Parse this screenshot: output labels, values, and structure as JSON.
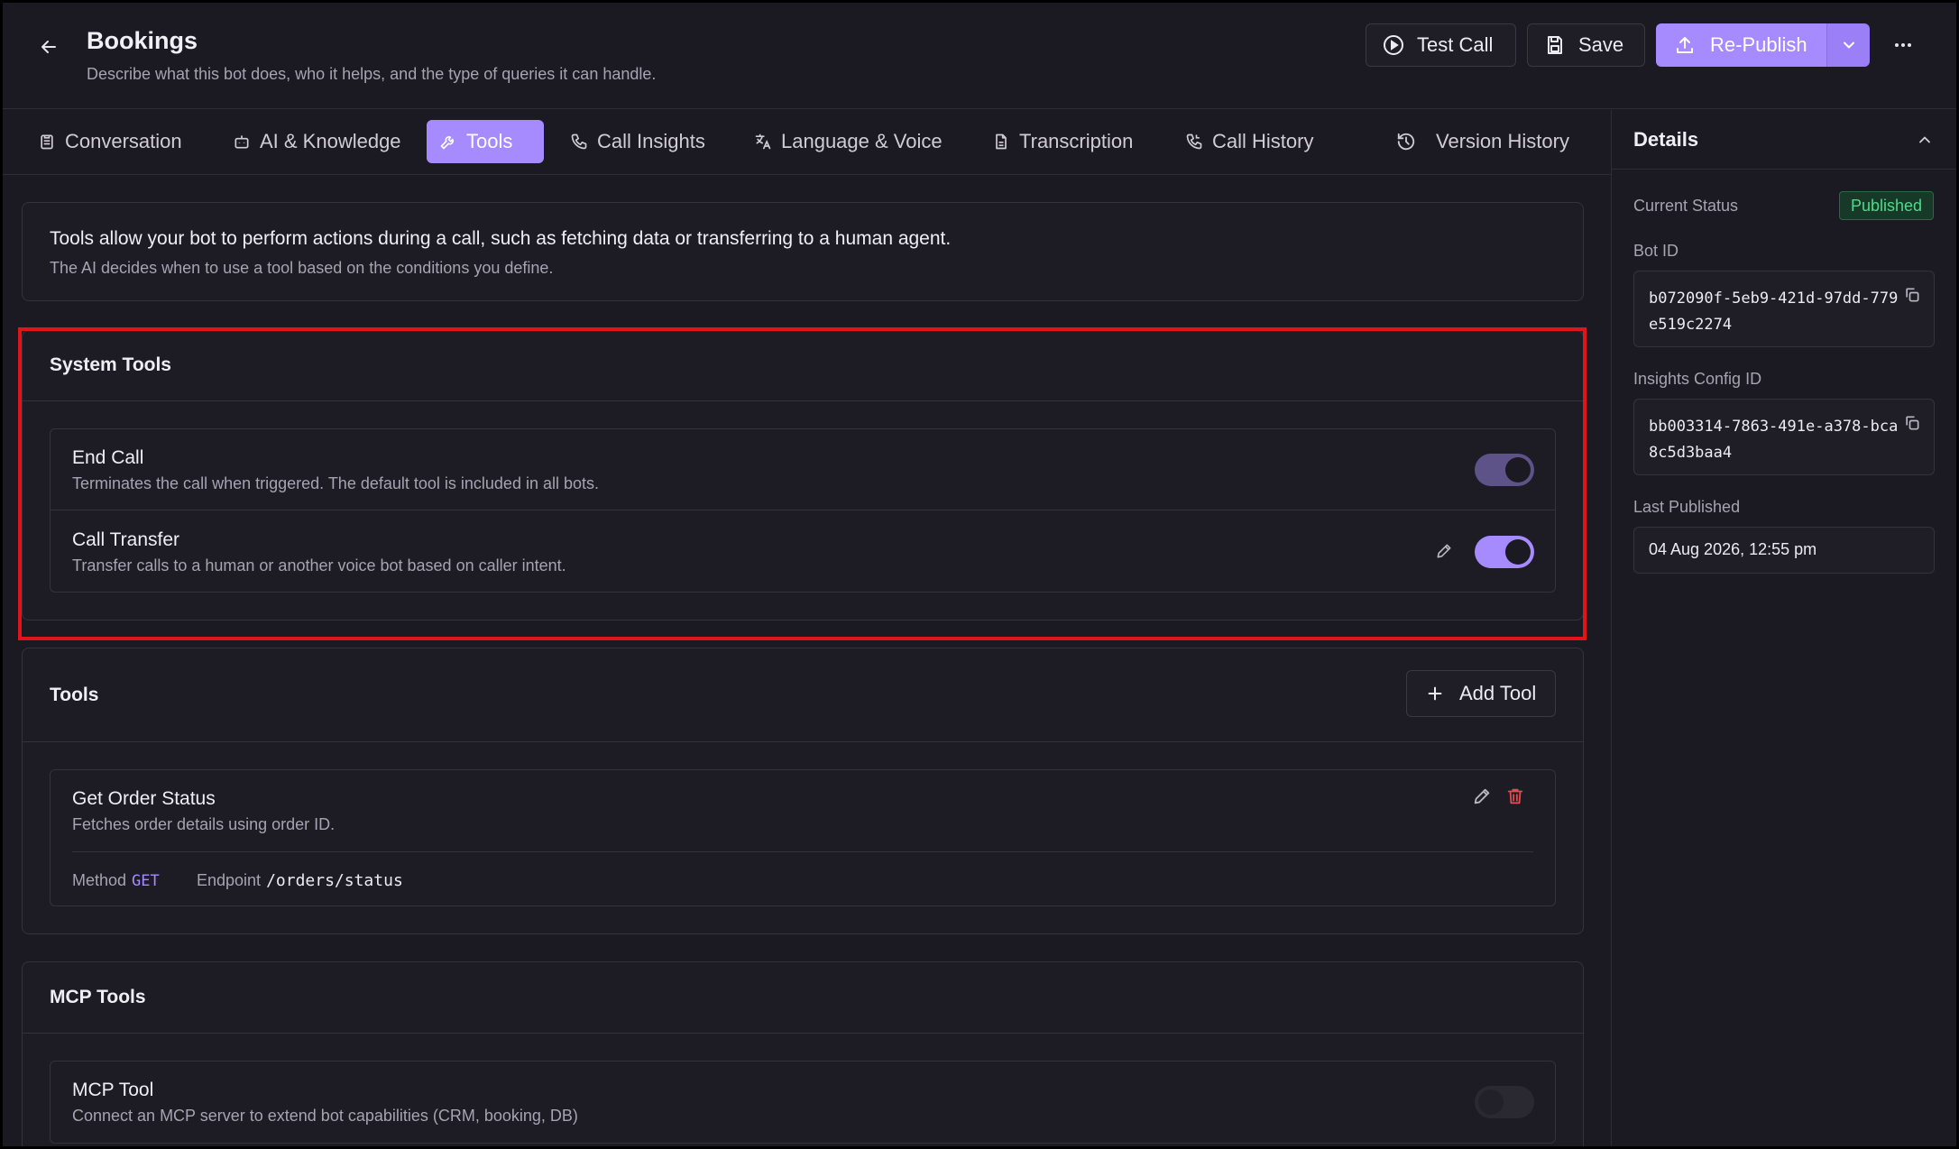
{
  "header": {
    "title": "Bookings",
    "subtitle": "Describe what this bot does, who it helps, and the type of queries it can handle.",
    "test_call_label": "Test Call",
    "save_label": "Save",
    "republish_label": "Re-Publish"
  },
  "tabs": [
    {
      "label": "Conversation",
      "icon": "clipboard-icon"
    },
    {
      "label": "AI & Knowledge",
      "icon": "robot-icon"
    },
    {
      "label": "Tools",
      "icon": "wrench-icon",
      "active": true
    },
    {
      "label": "Call Insights",
      "icon": "phone-icon"
    },
    {
      "label": "Language & Voice",
      "icon": "translate-icon"
    },
    {
      "label": "Transcription",
      "icon": "document-icon"
    },
    {
      "label": "Call History",
      "icon": "phone-history-icon"
    },
    {
      "label": "Version History",
      "icon": "history-icon"
    }
  ],
  "info": {
    "title": "Tools allow your bot to perform actions during a call, such as fetching data or transferring to a human agent.",
    "subtitle": "The AI decides when to use a tool based on the conditions you define."
  },
  "system_tools": {
    "title": "System Tools",
    "items": [
      {
        "name": "End Call",
        "description": "Terminates the call when triggered. The default tool is included in all bots.",
        "enabled": true
      },
      {
        "name": "Call Transfer",
        "description": "Transfer calls to a human or another voice bot based on caller intent.",
        "enabled": true
      }
    ]
  },
  "tools": {
    "title": "Tools",
    "add_label": "Add Tool",
    "items": [
      {
        "name": "Get Order Status",
        "description": "Fetches order details using order ID.",
        "method_label": "Method",
        "method": "GET",
        "endpoint_label": "Endpoint",
        "endpoint": "/orders/status"
      }
    ]
  },
  "mcp_tools": {
    "title": "MCP Tools",
    "items": [
      {
        "name": "MCP Tool",
        "description": "Connect an MCP server to extend bot capabilities (CRM, booking, DB)",
        "enabled": false
      }
    ]
  },
  "details": {
    "title": "Details",
    "status_label": "Current Status",
    "status": "Published",
    "bot_id_label": "Bot ID",
    "bot_id": "b072090f-5eb9-421d-97dd-779e519c2274",
    "insights_label": "Insights Config ID",
    "insights_id": "bb003314-7863-491e-a378-bca8c5d3baa4",
    "last_published_label": "Last Published",
    "last_published": "04 Aug 2026, 12:55 pm"
  },
  "colors": {
    "accent": "#a58bff",
    "background": "#1b1a22",
    "danger": "#e5484d",
    "success": "#4fd98a"
  }
}
